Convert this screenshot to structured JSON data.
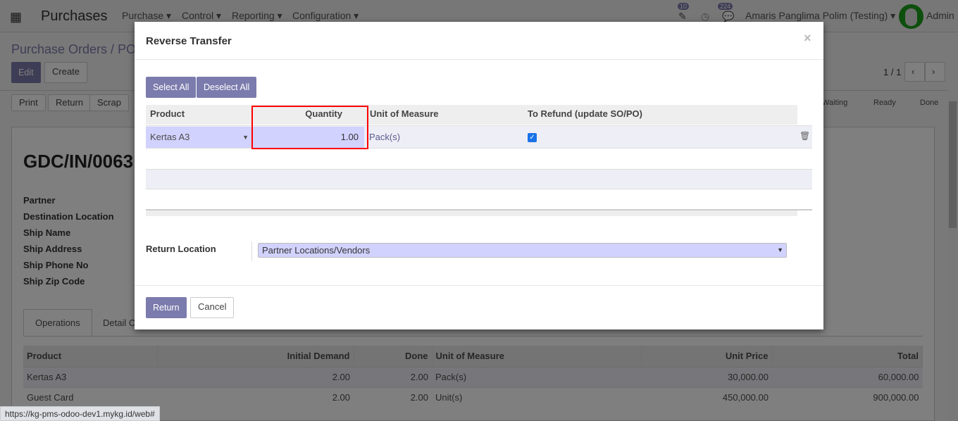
{
  "navbar": {
    "app_title": "Purchases",
    "menus": [
      "Purchase",
      "Control",
      "Reporting",
      "Configuration"
    ],
    "badge_edit": "10",
    "badge_chat": "224",
    "company": "Amaris Panglima Polim (Testing)",
    "user": "Admin"
  },
  "breadcrumb": {
    "parent": "Purchase Orders /",
    "current": "PO"
  },
  "buttons": {
    "edit": "Edit",
    "create": "Create",
    "print": "Print",
    "return": "Return",
    "scrap": "Scrap"
  },
  "pager": {
    "text": "1 / 1"
  },
  "statusbar": [
    "Waiting",
    "Ready",
    "Done"
  ],
  "record": {
    "name": "GDC/IN/0063",
    "labels": [
      "Partner",
      "Destination Location",
      "Ship Name",
      "Ship Address",
      "Ship Phone No",
      "Ship Zip Code"
    ]
  },
  "tabs": [
    "Operations",
    "Detail O"
  ],
  "operations": {
    "headers": [
      "Product",
      "Initial Demand",
      "Done",
      "Unit of Measure",
      "Unit Price",
      "Total"
    ],
    "rows": [
      [
        "Kertas A3",
        "2.00",
        "2.00",
        "Pack(s)",
        "30,000.00",
        "60,000.00"
      ],
      [
        "Guest Card",
        "2.00",
        "2.00",
        "Unit(s)",
        "450,000.00",
        "900,000.00"
      ]
    ]
  },
  "status_url": "https://kg-pms-odoo-dev1.mykg.id/web#",
  "modal": {
    "title": "Reverse Transfer",
    "close": "×",
    "select_all": "Select All",
    "deselect_all": "Deselect All",
    "headers": [
      "Product",
      "Quantity",
      "Unit of Measure",
      "To Refund (update SO/PO)"
    ],
    "row": {
      "product": "Kertas A3",
      "quantity": "1.00",
      "uom": "Pack(s)",
      "refund": true
    },
    "return_location_label": "Return Location",
    "return_location": "Partner Locations/Vendors",
    "return": "Return",
    "cancel": "Cancel"
  },
  "colors": {
    "primary": "#7c7bad",
    "highlight": "#ff0000"
  }
}
